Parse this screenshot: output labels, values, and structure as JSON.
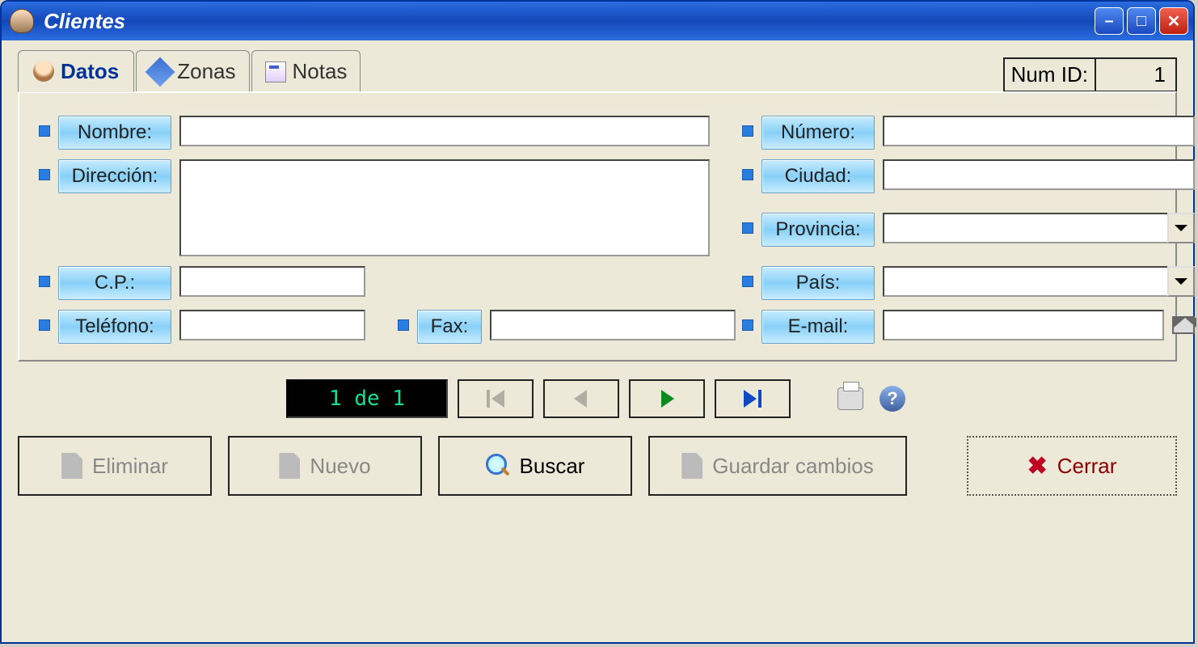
{
  "window": {
    "title": "Clientes"
  },
  "tabs": {
    "datos": "Datos",
    "zonas": "Zonas",
    "notas": "Notas"
  },
  "numid": {
    "label": "Num ID:",
    "value": "1"
  },
  "fields": {
    "nombre": {
      "label": "Nombre:",
      "value": ""
    },
    "direccion": {
      "label": "Dirección:",
      "value": ""
    },
    "cp": {
      "label": "C.P.:",
      "value": ""
    },
    "telefono": {
      "label": "Teléfono:",
      "value": ""
    },
    "fax": {
      "label": "Fax:",
      "value": ""
    },
    "numero": {
      "label": "Número:",
      "value": ""
    },
    "ciudad": {
      "label": "Ciudad:",
      "value": ""
    },
    "provincia": {
      "label": "Provincia:",
      "value": ""
    },
    "pais": {
      "label": "País:",
      "value": ""
    },
    "email": {
      "label": "E-mail:",
      "value": ""
    }
  },
  "nav": {
    "counter": "1 de 1"
  },
  "buttons": {
    "eliminar": "Eliminar",
    "nuevo": "Nuevo",
    "buscar": "Buscar",
    "guardar": "Guardar cambios",
    "cerrar": "Cerrar"
  }
}
